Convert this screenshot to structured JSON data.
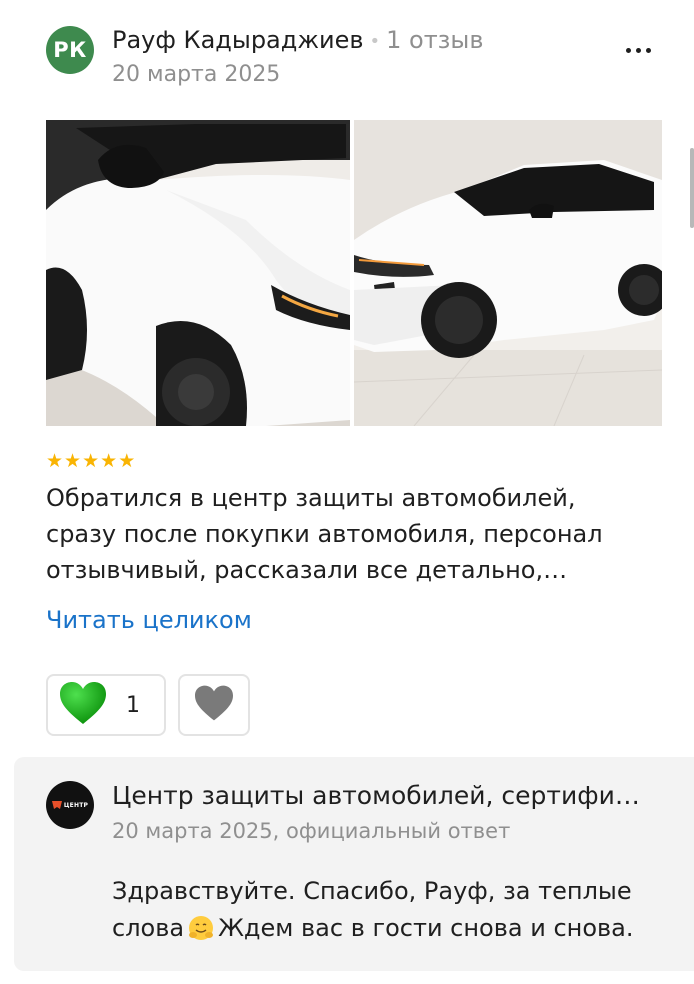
{
  "author": {
    "initials": "РК",
    "name": "Рауф Кадыраджиев",
    "review_count": "1 отзыв",
    "date": "20 марта 2025",
    "avatar_color": "#3e8a4e"
  },
  "photos": [
    {
      "icon": "car-photo-front-closeup"
    },
    {
      "icon": "car-photo-side-view"
    }
  ],
  "rating": {
    "stars": 5,
    "max": 5,
    "star_color": "#f9b403"
  },
  "review_text": "Обратился в центр защиты автомобилей, сразу после покупки автомобиля, персонал отзывчивый, рассказали все детально,…",
  "read_more_label": "Читать целиком",
  "reactions": {
    "like_count": "1",
    "like_color": "#17a717",
    "dislike_color": "#7a7a7a"
  },
  "reply": {
    "org_name": "Центр защиты автомобилей, сертифи…",
    "logo_text": "ЦЕНТР",
    "meta": "20 марта 2025, официальный ответ",
    "text_before_emoji": "Здравствуйте. Спасибо, Рауф, за теплые слова",
    "emoji": "hugging-face-icon",
    "text_after_emoji": "Ждем вас в гости снова и снова."
  },
  "colors": {
    "link": "#1a73c9",
    "muted": "#8f8f8f",
    "reply_bg": "#f3f3f3"
  }
}
